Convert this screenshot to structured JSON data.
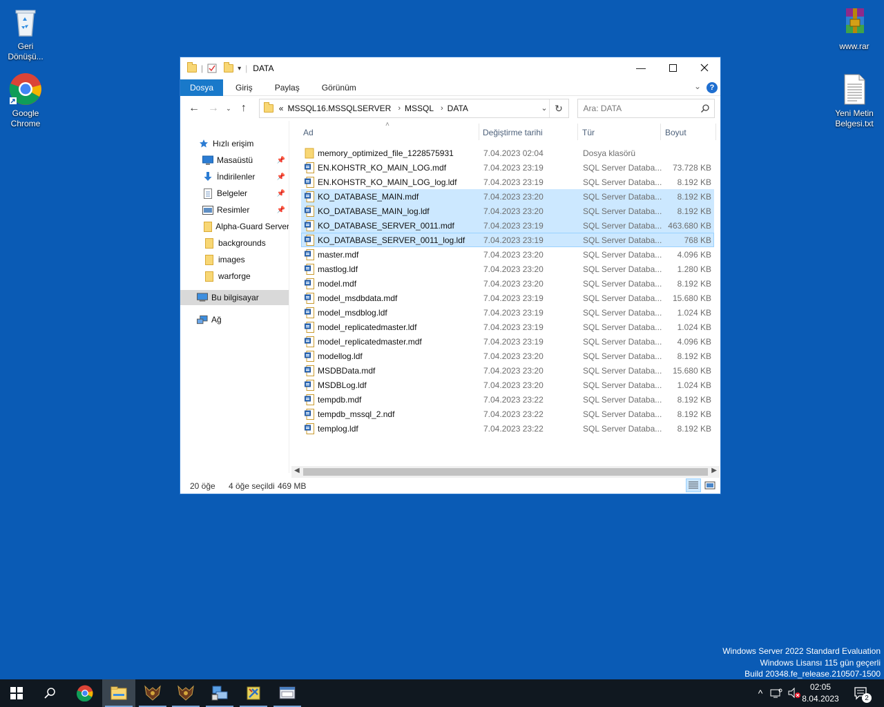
{
  "desktop": {
    "icons": [
      {
        "label": "Geri Dönüşü..."
      },
      {
        "label": "Google Chrome"
      },
      {
        "label": "www.rar"
      },
      {
        "label": "Yeni Metin Belgesi.txt"
      }
    ]
  },
  "window": {
    "title": "DATA",
    "ribbon_tabs": [
      "Dosya",
      "Giriş",
      "Paylaş",
      "Görünüm"
    ],
    "address": {
      "overflow": "«",
      "crumbs": [
        "MSSQL16.MSSQLSERVER",
        "MSSQL",
        "DATA"
      ]
    },
    "search": {
      "placeholder": "Ara: DATA"
    },
    "nav_pane": {
      "quick_access": "Hızlı erişim",
      "pinned": [
        "Masaüstü",
        "İndirilenler",
        "Belgeler",
        "Resimler"
      ],
      "folders": [
        "Alpha-Guard Server",
        "backgrounds",
        "images",
        "warforge"
      ],
      "this_pc": "Bu bilgisayar",
      "network": "Ağ"
    },
    "columns": {
      "name": "Ad",
      "date": "Değiştirme tarihi",
      "type": "Tür",
      "size": "Boyut"
    },
    "files": [
      {
        "name": "memory_optimized_file_1228575931",
        "date": "7.04.2023 02:04",
        "type": "Dosya klasörü",
        "size": "",
        "kind": "folder",
        "selected": false
      },
      {
        "name": "EN.KOHSTR_KO_MAIN_LOG.mdf",
        "date": "7.04.2023 23:19",
        "type": "SQL Server Databa...",
        "size": "73.728 KB",
        "kind": "db",
        "selected": false
      },
      {
        "name": "EN.KOHSTR_KO_MAIN_LOG_log.ldf",
        "date": "7.04.2023 23:19",
        "type": "SQL Server Databa...",
        "size": "8.192 KB",
        "kind": "db",
        "selected": false
      },
      {
        "name": "KO_DATABASE_MAIN.mdf",
        "date": "7.04.2023 23:20",
        "type": "SQL Server Databa...",
        "size": "8.192 KB",
        "kind": "db",
        "selected": true
      },
      {
        "name": "KO_DATABASE_MAIN_log.ldf",
        "date": "7.04.2023 23:20",
        "type": "SQL Server Databa...",
        "size": "8.192 KB",
        "kind": "db",
        "selected": true
      },
      {
        "name": "KO_DATABASE_SERVER_0011.mdf",
        "date": "7.04.2023 23:19",
        "type": "SQL Server Databa...",
        "size": "463.680 KB",
        "kind": "db",
        "selected": true
      },
      {
        "name": "KO_DATABASE_SERVER_0011_log.ldf",
        "date": "7.04.2023 23:19",
        "type": "SQL Server Databa...",
        "size": "768 KB",
        "kind": "db",
        "selected": true
      },
      {
        "name": "master.mdf",
        "date": "7.04.2023 23:20",
        "type": "SQL Server Databa...",
        "size": "4.096 KB",
        "kind": "db",
        "selected": false
      },
      {
        "name": "mastlog.ldf",
        "date": "7.04.2023 23:20",
        "type": "SQL Server Databa...",
        "size": "1.280 KB",
        "kind": "db",
        "selected": false
      },
      {
        "name": "model.mdf",
        "date": "7.04.2023 23:20",
        "type": "SQL Server Databa...",
        "size": "8.192 KB",
        "kind": "db",
        "selected": false
      },
      {
        "name": "model_msdbdata.mdf",
        "date": "7.04.2023 23:19",
        "type": "SQL Server Databa...",
        "size": "15.680 KB",
        "kind": "db",
        "selected": false
      },
      {
        "name": "model_msdblog.ldf",
        "date": "7.04.2023 23:19",
        "type": "SQL Server Databa...",
        "size": "1.024 KB",
        "kind": "db",
        "selected": false
      },
      {
        "name": "model_replicatedmaster.ldf",
        "date": "7.04.2023 23:19",
        "type": "SQL Server Databa...",
        "size": "1.024 KB",
        "kind": "db",
        "selected": false
      },
      {
        "name": "model_replicatedmaster.mdf",
        "date": "7.04.2023 23:19",
        "type": "SQL Server Databa...",
        "size": "4.096 KB",
        "kind": "db",
        "selected": false
      },
      {
        "name": "modellog.ldf",
        "date": "7.04.2023 23:20",
        "type": "SQL Server Databa...",
        "size": "8.192 KB",
        "kind": "db",
        "selected": false
      },
      {
        "name": "MSDBData.mdf",
        "date": "7.04.2023 23:20",
        "type": "SQL Server Databa...",
        "size": "15.680 KB",
        "kind": "db",
        "selected": false
      },
      {
        "name": "MSDBLog.ldf",
        "date": "7.04.2023 23:20",
        "type": "SQL Server Databa...",
        "size": "1.024 KB",
        "kind": "db",
        "selected": false
      },
      {
        "name": "tempdb.mdf",
        "date": "7.04.2023 23:22",
        "type": "SQL Server Databa...",
        "size": "8.192 KB",
        "kind": "db",
        "selected": false
      },
      {
        "name": "tempdb_mssql_2.ndf",
        "date": "7.04.2023 23:22",
        "type": "SQL Server Databa...",
        "size": "8.192 KB",
        "kind": "db",
        "selected": false
      },
      {
        "name": "templog.ldf",
        "date": "7.04.2023 23:22",
        "type": "SQL Server Databa...",
        "size": "8.192 KB",
        "kind": "db",
        "selected": false
      }
    ],
    "status": {
      "count": "20 öğe",
      "selection": "4 öğe seçildi",
      "size": "469 MB"
    }
  },
  "watermark": {
    "line1": "Windows Server 2022 Standard Evaluation",
    "line2": "Windows Lisansı 115 gün geçerli",
    "line3": "Build 20348.fe_release.210507-1500"
  },
  "taskbar": {
    "clock_time": "02:05",
    "clock_date": "8.04.2023",
    "notifications": "2"
  },
  "colors": {
    "desktop": "#0a5bb5",
    "accent": "#1979ca",
    "selection": "#cce8ff",
    "taskbar": "#101820"
  }
}
